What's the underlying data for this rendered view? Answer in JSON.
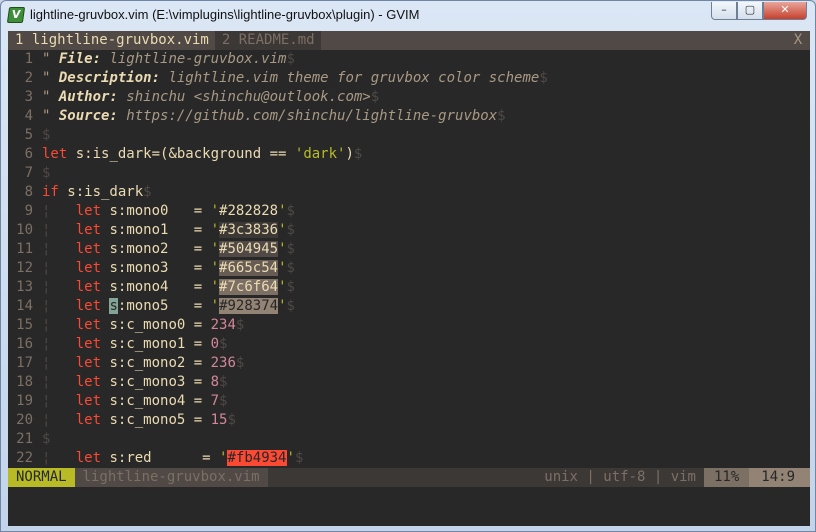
{
  "window": {
    "title": "lightline-gruvbox.vim (E:\\vimplugins\\lightline-gruvbox\\plugin) - GVIM",
    "app_icon": "gvim-icon",
    "controls": {
      "minimize": "–",
      "maximize": "▢",
      "close": "✕"
    }
  },
  "tabline": {
    "tabs": [
      {
        "label": "1 lightline-gruvbox.vim",
        "active": true
      },
      {
        "label": "2 README.md",
        "active": false
      }
    ],
    "close_label": "X"
  },
  "colors": {
    "bg": "#282828",
    "fg": "#ebdbb2",
    "comment": "#a89984",
    "keyword": "#fb4934",
    "string": "#b8bb26",
    "number": "#d3869b",
    "identifier": "#83a598",
    "eol": "#504945",
    "linenr": "#7c6f64",
    "indent": "#504945"
  },
  "lines": [
    {
      "n": "1",
      "tokens": [
        [
          "\" ",
          "c"
        ],
        [
          "File:",
          "ci"
        ],
        [
          " lightline-gruvbox.vim",
          "c"
        ],
        [
          "$",
          "e"
        ]
      ]
    },
    {
      "n": "2",
      "tokens": [
        [
          "\" ",
          "c"
        ],
        [
          "Description:",
          "ci"
        ],
        [
          " lightline.vim theme for gruvbox color scheme",
          "c"
        ],
        [
          "$",
          "e"
        ]
      ]
    },
    {
      "n": "3",
      "tokens": [
        [
          "\" ",
          "c"
        ],
        [
          "Author:",
          "ci"
        ],
        [
          " shinchu <shinchu@outlook.com>",
          "c"
        ],
        [
          "$",
          "e"
        ]
      ]
    },
    {
      "n": "4",
      "tokens": [
        [
          "\" ",
          "c"
        ],
        [
          "Source:",
          "ci"
        ],
        [
          " https://github.com/shinchu/lightline-gruvbox",
          "c"
        ],
        [
          "$",
          "e"
        ]
      ]
    },
    {
      "n": "5",
      "tokens": [
        [
          "$",
          "e"
        ]
      ]
    },
    {
      "n": "6",
      "tokens": [
        [
          "let",
          "k"
        ],
        [
          " s:is_dark",
          "f"
        ],
        [
          "=(&background == ",
          "f"
        ],
        [
          "'dark'",
          "s"
        ],
        [
          ")",
          "f"
        ],
        [
          "$",
          "e"
        ]
      ]
    },
    {
      "n": "7",
      "tokens": [
        [
          "$",
          "e"
        ]
      ]
    },
    {
      "n": "8",
      "tokens": [
        [
          "if",
          "k"
        ],
        [
          " s:is_dark",
          "f"
        ],
        [
          "$",
          "e"
        ]
      ]
    },
    {
      "n": "9",
      "tokens": [
        [
          "¦",
          "i"
        ],
        [
          "   ",
          "f"
        ],
        [
          "let",
          "k"
        ],
        [
          " s:mono0   = ",
          "f"
        ],
        [
          "'",
          "s"
        ],
        [
          "#282828",
          "hw:#282828:#ebdbb2"
        ],
        [
          "'",
          "s"
        ],
        [
          "$",
          "e"
        ]
      ]
    },
    {
      "n": "10",
      "tokens": [
        [
          "¦",
          "i"
        ],
        [
          "   ",
          "f"
        ],
        [
          "let",
          "k"
        ],
        [
          " s:mono1   = ",
          "f"
        ],
        [
          "'",
          "s"
        ],
        [
          "#3c3836",
          "hw:#3c3836:#ebdbb2"
        ],
        [
          "'",
          "s"
        ],
        [
          "$",
          "e"
        ]
      ]
    },
    {
      "n": "11",
      "tokens": [
        [
          "¦",
          "i"
        ],
        [
          "   ",
          "f"
        ],
        [
          "let",
          "k"
        ],
        [
          " s:mono2   = ",
          "f"
        ],
        [
          "'",
          "s"
        ],
        [
          "#504945",
          "hw:#504945:#ebdbb2"
        ],
        [
          "'",
          "s"
        ],
        [
          "$",
          "e"
        ]
      ]
    },
    {
      "n": "12",
      "tokens": [
        [
          "¦",
          "i"
        ],
        [
          "   ",
          "f"
        ],
        [
          "let",
          "k"
        ],
        [
          " s:mono3   = ",
          "f"
        ],
        [
          "'",
          "s"
        ],
        [
          "#665c54",
          "hw:#665c54:#ebdbb2"
        ],
        [
          "'",
          "s"
        ],
        [
          "$",
          "e"
        ]
      ]
    },
    {
      "n": "13",
      "tokens": [
        [
          "¦",
          "i"
        ],
        [
          "   ",
          "f"
        ],
        [
          "let",
          "k"
        ],
        [
          " s:mono4   = ",
          "f"
        ],
        [
          "'",
          "s"
        ],
        [
          "#7c6f64",
          "hw:#7c6f64:#ebdbb2"
        ],
        [
          "'",
          "s"
        ],
        [
          "$",
          "e"
        ]
      ]
    },
    {
      "n": "14",
      "tokens": [
        [
          "¦",
          "i"
        ],
        [
          "   ",
          "f"
        ],
        [
          "let",
          "k"
        ],
        [
          " ",
          "f"
        ],
        [
          "s",
          "cur"
        ],
        [
          ":mono5   = ",
          "f"
        ],
        [
          "'",
          "s"
        ],
        [
          "#928374",
          "hw:#928374:#282828"
        ],
        [
          "'",
          "s"
        ],
        [
          "$",
          "e"
        ]
      ]
    },
    {
      "n": "15",
      "tokens": [
        [
          "¦",
          "i"
        ],
        [
          "   ",
          "f"
        ],
        [
          "let",
          "k"
        ],
        [
          " s:c_mono0 = ",
          "f"
        ],
        [
          "234",
          "n"
        ],
        [
          "$",
          "e"
        ]
      ]
    },
    {
      "n": "16",
      "tokens": [
        [
          "¦",
          "i"
        ],
        [
          "   ",
          "f"
        ],
        [
          "let",
          "k"
        ],
        [
          " s:c_mono1 = ",
          "f"
        ],
        [
          "0",
          "n"
        ],
        [
          "$",
          "e"
        ]
      ]
    },
    {
      "n": "17",
      "tokens": [
        [
          "¦",
          "i"
        ],
        [
          "   ",
          "f"
        ],
        [
          "let",
          "k"
        ],
        [
          " s:c_mono2 = ",
          "f"
        ],
        [
          "236",
          "n"
        ],
        [
          "$",
          "e"
        ]
      ]
    },
    {
      "n": "18",
      "tokens": [
        [
          "¦",
          "i"
        ],
        [
          "   ",
          "f"
        ],
        [
          "let",
          "k"
        ],
        [
          " s:c_mono3 = ",
          "f"
        ],
        [
          "8",
          "n"
        ],
        [
          "$",
          "e"
        ]
      ]
    },
    {
      "n": "19",
      "tokens": [
        [
          "¦",
          "i"
        ],
        [
          "   ",
          "f"
        ],
        [
          "let",
          "k"
        ],
        [
          " s:c_mono4 = ",
          "f"
        ],
        [
          "7",
          "n"
        ],
        [
          "$",
          "e"
        ]
      ]
    },
    {
      "n": "20",
      "tokens": [
        [
          "¦",
          "i"
        ],
        [
          "   ",
          "f"
        ],
        [
          "let",
          "k"
        ],
        [
          " s:c_mono5 = ",
          "f"
        ],
        [
          "15",
          "n"
        ],
        [
          "$",
          "e"
        ]
      ]
    },
    {
      "n": "21",
      "tokens": [
        [
          "$",
          "e"
        ]
      ]
    },
    {
      "n": "22",
      "tokens": [
        [
          "¦",
          "i"
        ],
        [
          "   ",
          "f"
        ],
        [
          "let",
          "k"
        ],
        [
          " s:red      = ",
          "f"
        ],
        [
          "'",
          "s"
        ],
        [
          "#fb4934",
          "hw:#fb4934:#282828"
        ],
        [
          "'",
          "s"
        ],
        [
          "$",
          "e"
        ]
      ]
    }
  ],
  "statusline": {
    "mode": "NORMAL",
    "filename": "lightline-gruvbox.vim",
    "fileformat": "unix | utf-8 | vim",
    "percent": "11%",
    "position": "14:9"
  }
}
